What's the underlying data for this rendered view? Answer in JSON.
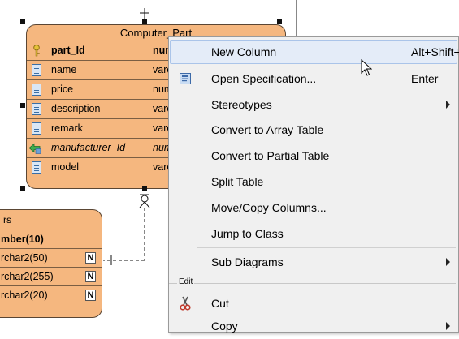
{
  "entity_main": {
    "title": "Computer_Part",
    "rows": [
      {
        "name": "part_Id",
        "type": "num",
        "kind": "pk"
      },
      {
        "name": "name",
        "type": "varc",
        "kind": "col"
      },
      {
        "name": "price",
        "type": "num",
        "kind": "col"
      },
      {
        "name": "description",
        "type": "varc",
        "kind": "col"
      },
      {
        "name": "remark",
        "type": "varc",
        "kind": "col"
      },
      {
        "name": "manufacturer_Id",
        "type": "num",
        "kind": "fk"
      },
      {
        "name": "model",
        "type": "varc",
        "kind": "col"
      }
    ]
  },
  "entity_left": {
    "title": "rs",
    "rows": [
      {
        "text": "mber(10)",
        "kind": "pk"
      },
      {
        "text": "rchar2(50)",
        "badge": "N"
      },
      {
        "text": "rchar2(255)",
        "badge": "N"
      },
      {
        "text": "rchar2(20)",
        "badge": "N"
      }
    ]
  },
  "menu": {
    "items": [
      {
        "label": "New Column",
        "shortcut": "Alt+Shift+C"
      },
      {
        "label": "Open Specification...",
        "shortcut": "Enter",
        "icon": "specification-icon"
      },
      {
        "label": "Stereotypes",
        "submenu": true
      },
      {
        "label": "Convert to Array Table"
      },
      {
        "label": "Convert to Partial Table"
      },
      {
        "label": "Split Table"
      },
      {
        "label": "Move/Copy Columns..."
      },
      {
        "label": "Jump to Class"
      },
      {
        "label": "Sub Diagrams",
        "submenu": true
      },
      {
        "label": "Cut",
        "icon": "scissors-icon"
      },
      {
        "label": "Copy",
        "submenu": true
      }
    ],
    "group_edit": "Edit"
  },
  "colors": {
    "entity_fill": "#f5b77f",
    "menu_bg": "#f0f0f0",
    "highlight": "#e4ecf8"
  }
}
